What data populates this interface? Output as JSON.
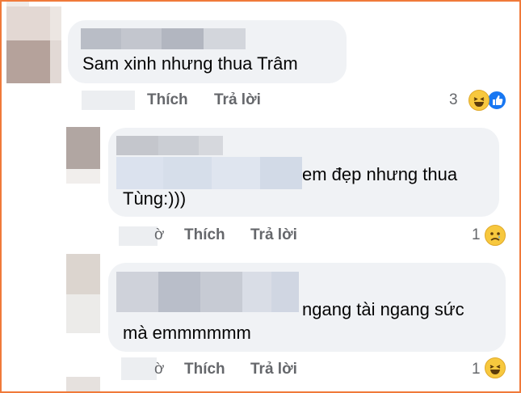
{
  "comments": [
    {
      "text": "Sam xinh nhưng thua Trâm",
      "actions": {
        "like": "Thích",
        "reply": "Trả lời"
      },
      "reaction_count": "3",
      "reaction_icons": [
        "laugh-emoji-icon",
        "like-reaction-icon"
      ]
    },
    {
      "text_line1": "em đẹp nhưng thua",
      "text_line2": "Tùng:)))",
      "time_fragment": "ờ",
      "actions": {
        "like": "Thích",
        "reply": "Trả lời"
      },
      "reaction_count": "1",
      "reaction_icons": [
        "sad-emoji-icon"
      ]
    },
    {
      "text_line1": "ngang tài ngang sức",
      "text_line2": "mà emmmmmm",
      "time_fragment": "ờ",
      "actions": {
        "like": "Thích",
        "reply": "Trả lời"
      },
      "reaction_count": "1",
      "reaction_icons": [
        "laugh-emoji-icon"
      ]
    }
  ],
  "colors": {
    "bubble": "#f0f2f5",
    "action_text": "#65676b",
    "frame": "#f07a3a",
    "like_blue": "#1877f2",
    "emoji_yellow": "#f7c83e"
  }
}
